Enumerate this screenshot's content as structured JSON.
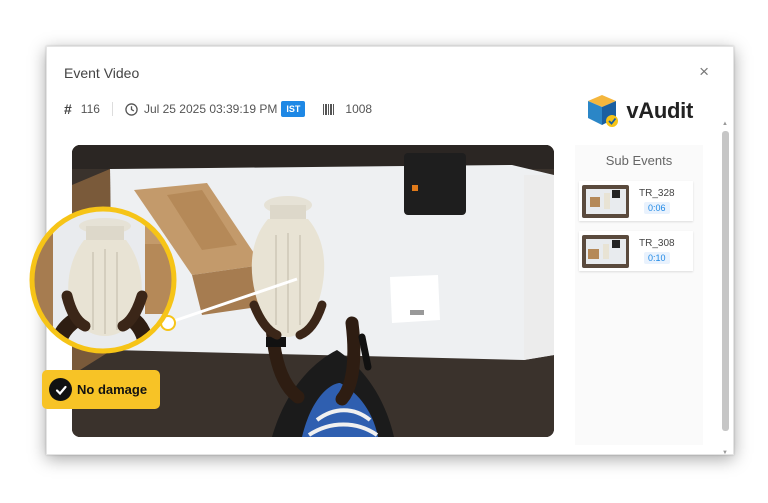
{
  "modal": {
    "title": "Event Video",
    "close": "×",
    "meta": {
      "id_prefix": "#",
      "id": "116",
      "datetime": "Jul 25 2025 03:39:19 PM",
      "timezone": "IST",
      "barcode_value": "1008"
    },
    "brand": "vAudit",
    "sub_events": {
      "title": "Sub Events",
      "items": [
        {
          "name": "TR_328",
          "time": "0:06"
        },
        {
          "name": "TR_308",
          "time": "0:10"
        }
      ]
    }
  },
  "badge": {
    "label": "No damage"
  },
  "colors": {
    "accent_blue": "#1e88e5",
    "badge_yellow": "#f7c326",
    "ring_yellow": "#f6c417"
  },
  "icons": [
    "close-icon",
    "clock-icon",
    "barcode-icon",
    "vaudit-logo-icon",
    "checkmark-icon"
  ]
}
